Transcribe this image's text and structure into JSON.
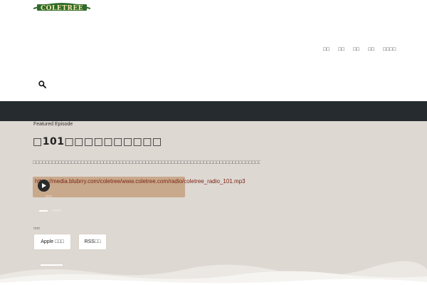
{
  "brand": {
    "logo_text": "COLETREE",
    "logo_color": "#2f6b2c"
  },
  "nav": {
    "items": [
      {
        "label": "□□"
      },
      {
        "label": "□□"
      },
      {
        "label": "□□"
      },
      {
        "label": "□□"
      },
      {
        "label": "□□□□"
      }
    ]
  },
  "header": {
    "search_icon": "search-icon"
  },
  "featured": {
    "label": "Featured Episode",
    "title": "□101□□□□□□□□□□",
    "description": "□□□□□□□□□□□□□□□□□□□□□□□□□□□□□□□□□□□□□□□□□□□□□□□□□□□□□□□□□□□□□□□□□□□□□□□□□□□□□□□□□□□□□□□□□□□□□□□□□...",
    "media_url": "https://media.blubrry.com/coletree/www.coletree.com/radio/coletree_radio_101.mp3",
    "player_caption": "□□□",
    "time_label": "□□□□",
    "play_icon": "play-icon"
  },
  "subscribe": {
    "label": "□□□",
    "apple_label": "Apple □□□",
    "rss_label": "RSS□□"
  },
  "colors": {
    "dark_band": "#262b2f",
    "hero_bg": "#ddd8d2",
    "player_bg": "#c9a98c",
    "link": "#7a1f10"
  }
}
